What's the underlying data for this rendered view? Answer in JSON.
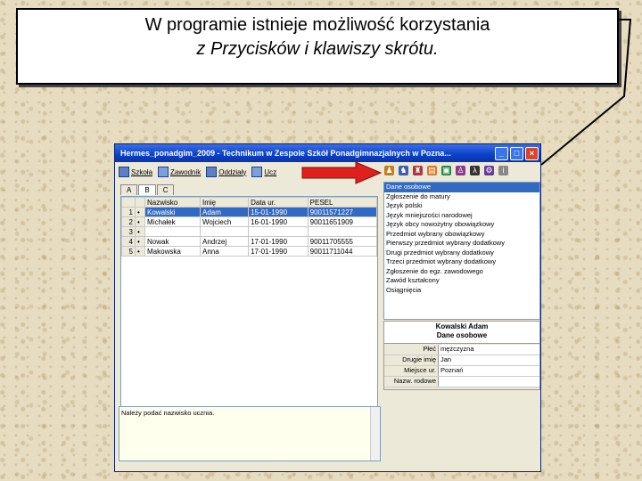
{
  "callout": {
    "line1": "W programie istnieje możliwość korzystania",
    "line2": "z Przycisków i klawiszy skrótu."
  },
  "window": {
    "title": "Hermes_ponadgim_2009 - Technikum w Zespole Szkół Ponadgimnazjalnych w Pozna...",
    "min": "_",
    "max": "□",
    "close": "×"
  },
  "toolbar": {
    "szkola": "Szkoła",
    "zawodnik": "Zawodnik",
    "oddzialy": "Oddziały",
    "uczniowie": "Ucz"
  },
  "tabs": [
    "A",
    "B",
    "C"
  ],
  "grid": {
    "headers": [
      "Nazwisko",
      "Imię",
      "Data ur.",
      "PESEL"
    ],
    "rows": [
      {
        "num": "1",
        "mark": "•",
        "nazwisko": "Kowalski",
        "imie": "Adam",
        "data": "15-01-1990",
        "pesel": "90011571227"
      },
      {
        "num": "2",
        "mark": "•",
        "nazwisko": "Michałek",
        "imie": "Wojciech",
        "data": "16-01-1990",
        "pesel": "90011651909"
      },
      {
        "num": "3",
        "mark": "•",
        "nazwisko": "",
        "imie": "",
        "data": "",
        "pesel": ""
      },
      {
        "num": "4",
        "mark": "•",
        "nazwisko": "Nowak",
        "imie": "Andrzej",
        "data": "17-01-1990",
        "pesel": "90011705555"
      },
      {
        "num": "5",
        "mark": "•",
        "nazwisko": "Makowska",
        "imie": "Anna",
        "data": "17-01-1990",
        "pesel": "90011711044"
      }
    ]
  },
  "options": [
    "Dane osobowe",
    "Zgłoszenie do matury",
    "Język polski",
    "Język mniejszości narodowej",
    "Język obcy nowożytny obowiązkowy",
    "Przedmiot wybrany obowiązkowy",
    "Pierwszy przedmiot wybrany dodatkowy",
    "Drugi przedmiot wybrany dodatkowy",
    "Trzeci przedmiot wybrany dodatkowy",
    "Zgłoszenie do egz. zawodowego",
    "Zawód kształcony",
    "Osiągnięcia"
  ],
  "card": {
    "name": "Kowalski Adam",
    "section": "Dane osobowe",
    "fields": [
      {
        "k": "Płeć",
        "v": "mężczyzna"
      },
      {
        "k": "Drugie imię",
        "v": "Jan"
      },
      {
        "k": "Miejsce ur.",
        "v": "Poznań"
      },
      {
        "k": "Nazw. rodowe",
        "v": ""
      }
    ]
  },
  "hint": "Należy podać nazwisko ucznia."
}
